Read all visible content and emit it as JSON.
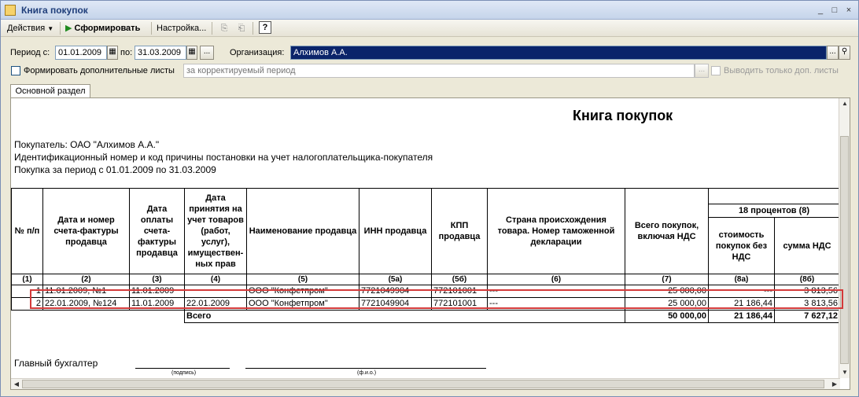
{
  "window": {
    "title": "Книга покупок",
    "controls": [
      "_",
      "□",
      "×"
    ]
  },
  "toolbar": {
    "actions_label": "Действия",
    "generate_label": "Сформировать",
    "settings_label": "Настройка..."
  },
  "period": {
    "from_label": "Период с:",
    "from_value": "01.01.2009",
    "to_label": "по:",
    "to_value": "31.03.2009",
    "ellipsis": "..."
  },
  "organization": {
    "label": "Организация:",
    "value": "Алхимов А.А."
  },
  "options": {
    "extra_sheets_label": "Формировать дополнительные листы",
    "corrected_period_placeholder": "за корректируемый период",
    "only_extra_label": "Выводить только доп. листы"
  },
  "tabs": {
    "main_label": "Основной раздел"
  },
  "report": {
    "title": "Книга покупок",
    "buyer": "Покупатель:  ОАО \"Алхимов А.А.\"",
    "inn_line": "Идентификационный номер и код причины постановки на учет налогоплательщика-покупателя",
    "period_line": "Покупка за период с 01.01.2009 по 31.03.2009",
    "headers": {
      "n": "№ п/п",
      "invoice": "Дата и номер счета-фактуры продавца",
      "pay_date": "Дата оплаты счета-фактуры продавца",
      "accept_date": "Дата принятия на учет товаров (работ, услуг), имуществен-ных прав",
      "seller": "Наименование продавца",
      "inn": "ИНН продавца",
      "kpp": "КПП продавца",
      "country": "Страна происхождения товара. Номер таможенной декларации",
      "total": "Всего покупок, включая НДС",
      "pct_group": "18 процентов (8)",
      "cost": "стоимость покупок без НДС",
      "vat": "сумма НДС"
    },
    "col_numbers": [
      "(1)",
      "(2)",
      "(3)",
      "(4)",
      "(5)",
      "(5а)",
      "(5б)",
      "(6)",
      "(7)",
      "(8а)",
      "(8б)"
    ],
    "rows": [
      {
        "n": "1",
        "invoice": "11.01.2009, №1",
        "pay_date": "11.01.2009",
        "accept_date": "",
        "seller": "ООО \"Конфетпром\"",
        "inn": "7721049904",
        "kpp": "772101001",
        "country": "---",
        "total": "25 000,00",
        "cost": "---",
        "vat": "3 813,56"
      },
      {
        "n": "2",
        "invoice": "22.01.2009, №124",
        "pay_date": "11.01.2009",
        "accept_date": "22.01.2009",
        "seller": "ООО \"Конфетпром\"",
        "inn": "7721049904",
        "kpp": "772101001",
        "country": "---",
        "total": "25 000,00",
        "cost": "21 186,44",
        "vat": "3 813,56"
      }
    ],
    "totals": {
      "label": "Всего",
      "total": "50 000,00",
      "cost": "21 186,44",
      "vat": "7 627,12"
    },
    "accountant": "Главный бухгалтер",
    "sign_caption": "(подпись)",
    "name_caption": "(ф.и.о.)"
  }
}
